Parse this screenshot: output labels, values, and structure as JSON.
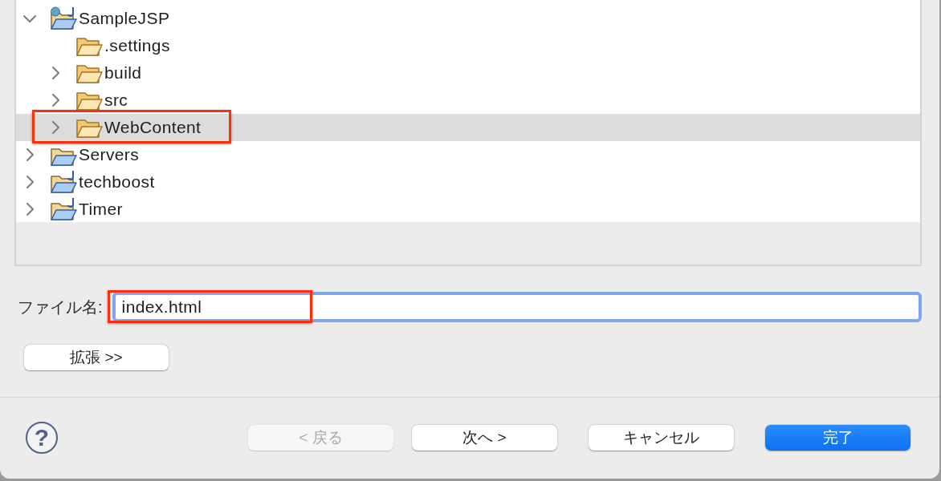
{
  "tree": {
    "items": [
      {
        "label": "SampleJSP",
        "kind": "web-project",
        "expandable": true,
        "expanded": true,
        "selected": false,
        "annotated": false,
        "children": [
          {
            "label": ".settings",
            "kind": "folder",
            "expandable": false,
            "selected": false,
            "annotated": false
          },
          {
            "label": "build",
            "kind": "folder",
            "expandable": true,
            "expanded": false,
            "selected": false,
            "annotated": false
          },
          {
            "label": "src",
            "kind": "folder",
            "expandable": true,
            "expanded": false,
            "selected": false,
            "annotated": false
          },
          {
            "label": "WebContent",
            "kind": "folder",
            "expandable": true,
            "expanded": false,
            "selected": true,
            "annotated": true
          }
        ]
      },
      {
        "label": "Servers",
        "kind": "project",
        "expandable": true,
        "expanded": false,
        "selected": false,
        "annotated": false
      },
      {
        "label": "techboost",
        "kind": "java-project",
        "expandable": true,
        "expanded": false,
        "selected": false,
        "annotated": false
      },
      {
        "label": "Timer",
        "kind": "java-project",
        "expandable": true,
        "expanded": false,
        "selected": false,
        "annotated": false
      }
    ]
  },
  "file_name": {
    "label": "ファイル名:",
    "value": "index.html",
    "focused": true,
    "annotated": true
  },
  "advanced_button": {
    "label": "拡張 >>"
  },
  "footer": {
    "help_button": {
      "label": "?"
    },
    "buttons": [
      {
        "label": "< 戻る",
        "disabled": true,
        "default": false
      },
      {
        "label": "次へ >",
        "disabled": false,
        "default": false
      },
      {
        "label": "キャンセル",
        "disabled": false,
        "default": false
      },
      {
        "label": "完了",
        "disabled": false,
        "default": true
      }
    ]
  }
}
